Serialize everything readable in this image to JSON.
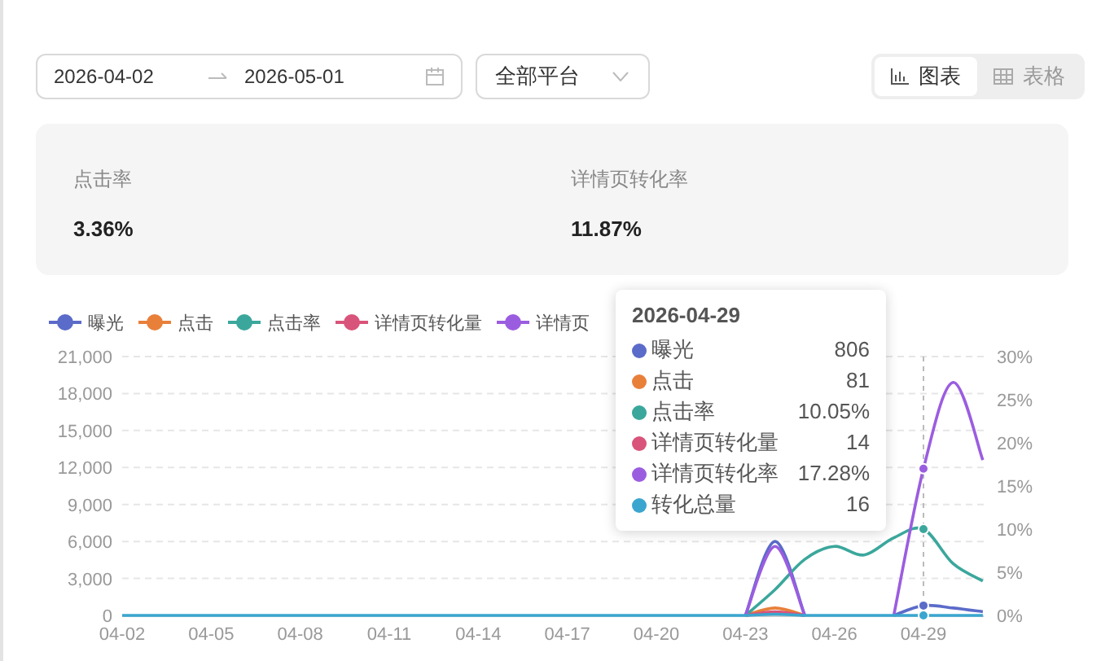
{
  "filters": {
    "start_date": "2026-04-02",
    "end_date": "2026-05-01",
    "platform": "全部平台"
  },
  "view_toggle": [
    {
      "label": "图表",
      "selected": true
    },
    {
      "label": "表格",
      "selected": false
    }
  ],
  "stats": [
    {
      "label": "点击率",
      "value": "3.36%"
    },
    {
      "label": "详情页转化率",
      "value": "11.87%"
    }
  ],
  "chart_data": {
    "type": "line",
    "legend": [
      {
        "label": "曝光",
        "color": "#5b6bc9"
      },
      {
        "label": "点击",
        "color": "#e8803a"
      },
      {
        "label": "点击率",
        "color": "#3ba79c"
      },
      {
        "label": "详情页转化量",
        "color": "#d9547a"
      },
      {
        "label": "详情页",
        "color": "#9b5de0"
      }
    ],
    "grid": true,
    "categories": [
      "04-02",
      null,
      null,
      "04-05",
      null,
      null,
      "04-08",
      null,
      null,
      "04-11",
      null,
      null,
      "04-14",
      null,
      null,
      "04-17",
      null,
      null,
      "04-20",
      null,
      null,
      "04-23",
      null,
      null,
      "04-26",
      null,
      null,
      "04-29",
      null,
      null
    ],
    "ylim": [
      0,
      21000
    ],
    "yticks": [
      {
        "value": 0,
        "label": "0"
      },
      {
        "value": 3000,
        "label": "3,000"
      },
      {
        "value": 6000,
        "label": "6,000"
      },
      {
        "value": 9000,
        "label": "9,000"
      },
      {
        "value": 12000,
        "label": "12,000"
      },
      {
        "value": 15000,
        "label": "15,000"
      },
      {
        "value": 18000,
        "label": "18,000"
      },
      {
        "value": 21000,
        "label": "21,000"
      }
    ],
    "y2lim": [
      0,
      30
    ],
    "y2ticks": [
      {
        "value": 0,
        "label": "0%"
      },
      {
        "value": 5,
        "label": "5%"
      },
      {
        "value": 10,
        "label": "10%"
      },
      {
        "value": 15,
        "label": "15%"
      },
      {
        "value": 20,
        "label": "20%"
      },
      {
        "value": 25,
        "label": "25%"
      },
      {
        "value": 30,
        "label": "30%"
      }
    ],
    "series": [
      {
        "name": "曝光",
        "color": "#5b6bc9",
        "values": [
          null,
          null,
          null,
          null,
          null,
          null,
          null,
          null,
          null,
          null,
          null,
          null,
          null,
          null,
          null,
          null,
          null,
          null,
          null,
          null,
          null,
          0,
          6000,
          0,
          null,
          null,
          0,
          800,
          600,
          300
        ]
      },
      {
        "name": "点击",
        "color": "#e8803a",
        "values": [
          null,
          null,
          null,
          null,
          null,
          null,
          null,
          null,
          null,
          null,
          null,
          null,
          null,
          null,
          null,
          null,
          null,
          null,
          null,
          null,
          null,
          0,
          600,
          0,
          null,
          null,
          null,
          null,
          null,
          null
        ]
      },
      {
        "name": "点击率",
        "color": "#3ba79c",
        "axis": "y2",
        "values": [
          null,
          null,
          null,
          null,
          null,
          null,
          null,
          null,
          null,
          null,
          null,
          null,
          null,
          null,
          null,
          null,
          null,
          null,
          null,
          null,
          null,
          0,
          3,
          6.5,
          8,
          7,
          9,
          10,
          6,
          4
        ]
      },
      {
        "name": "详情页转化量",
        "color": "#d9547a",
        "values": [
          null,
          null,
          null,
          null,
          null,
          null,
          null,
          null,
          null,
          null,
          null,
          null,
          null,
          null,
          null,
          null,
          null,
          null,
          null,
          null,
          null,
          0,
          300,
          0,
          null,
          null,
          null,
          null,
          null,
          null
        ]
      },
      {
        "name": "详情页转化率",
        "color": "#9b5de0",
        "axis": "y2",
        "values": [
          null,
          null,
          null,
          null,
          null,
          null,
          null,
          null,
          null,
          null,
          null,
          null,
          null,
          null,
          null,
          null,
          null,
          null,
          null,
          null,
          null,
          0,
          8,
          0,
          null,
          null,
          0,
          17,
          27,
          18
        ]
      },
      {
        "name": "转化总量",
        "color": "#3aa6d0",
        "values": [
          0,
          0,
          0,
          0,
          0,
          0,
          0,
          0,
          0,
          0,
          0,
          0,
          0,
          0,
          0,
          0,
          0,
          0,
          0,
          0,
          0,
          0,
          100,
          0,
          0,
          0,
          0,
          0,
          0,
          0
        ]
      }
    ]
  },
  "tooltip": {
    "title": "2026-04-29",
    "rows": [
      {
        "value": "806",
        "color": "#5b6bc9"
      },
      {
        "value": "81",
        "color": "#e8803a"
      },
      {
        "value": "10.05%",
        "color": "#3ba79c"
      },
      {
        "value": "14",
        "color": "#d9547a"
      },
      {
        "value": "17.28%",
        "color": "#9b5de0"
      },
      {
        "value": "16",
        "color": "#3aa6d0"
      }
    ]
  }
}
